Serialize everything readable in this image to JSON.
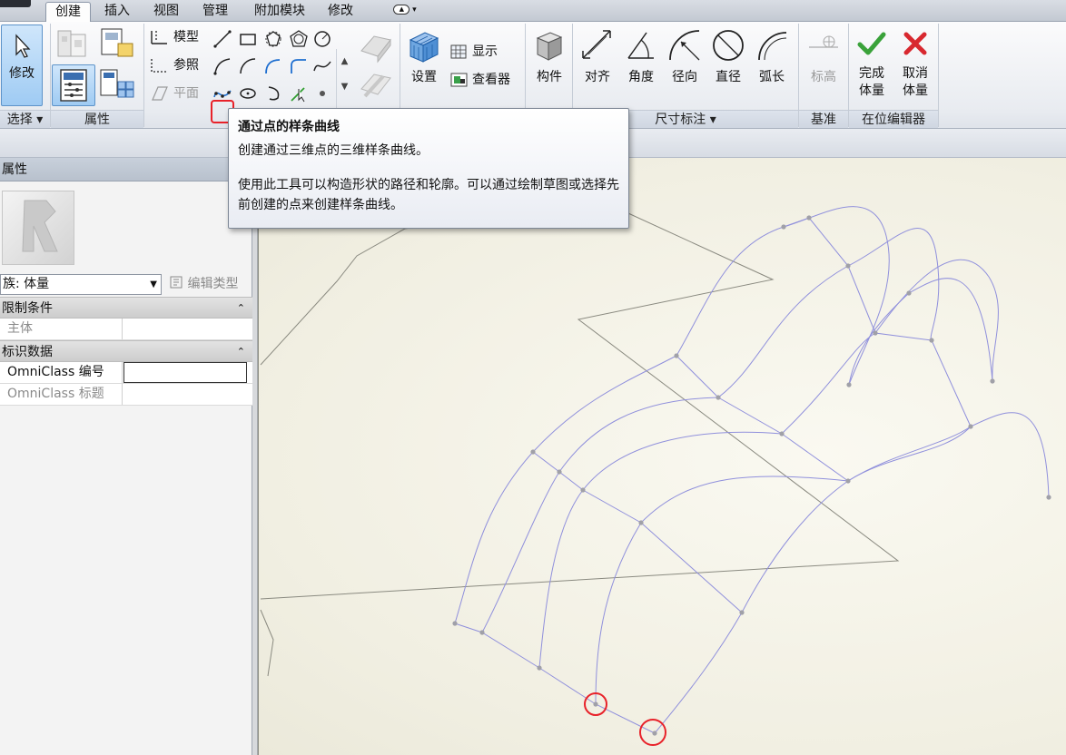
{
  "tabs": [
    "创建",
    "插入",
    "视图",
    "管理",
    "附加模块",
    "修改"
  ],
  "active_tab": "创建",
  "ribbon": {
    "modify_label": "修改",
    "model_label": "模型",
    "reference_label": "参照",
    "plane_label": "平面",
    "set_label": "设置",
    "show_label": "显示",
    "viewer_label": "查看器",
    "component_label": "构件",
    "align_label": "对齐",
    "angle_label": "角度",
    "radial_label": "径向",
    "diameter_label": "直径",
    "arc_length_label": "弧长",
    "level_label": "标高",
    "finish_mass_line1": "完成",
    "finish_mass_line2": "体量",
    "cancel_mass_line1": "取消",
    "cancel_mass_line2": "体量",
    "panels": {
      "select": "选择 ▾",
      "properties": "属性",
      "dimension": "尺寸标注 ▾",
      "datum": "基准",
      "inplace_editor": "在位编辑器"
    }
  },
  "tooltip": {
    "title": "通过点的样条曲线",
    "line1": "创建通过三维点的三维样条曲线。",
    "body": "使用此工具可以构造形状的路径和轮廓。可以通过绘制草图或选择先前创建的点来创建样条曲线。"
  },
  "properties": {
    "header": "属性",
    "type_selector": "族: 体量",
    "edit_type": "编辑类型",
    "sections": {
      "constraints": "限制条件",
      "identity": "标识数据"
    },
    "rows": {
      "host": "主体",
      "omniclass_number": "OmniClass 编号",
      "omniclass_title": "OmniClass 标题"
    }
  },
  "colors": {
    "accent": "#5d93c9",
    "highlight": "#e8222a",
    "spline": "#9090dc",
    "point": "#a0a0a8"
  }
}
